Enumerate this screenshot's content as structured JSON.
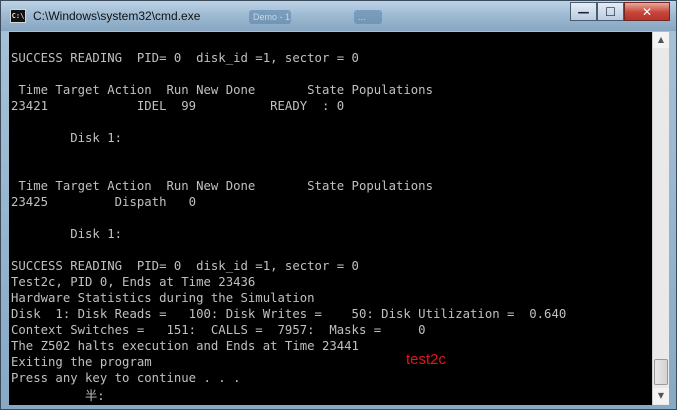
{
  "window": {
    "title": "C:\\Windows\\system32\\cmd.exe",
    "icon": "cmd-icon",
    "icon_text": "C:\\",
    "ghost_tabs": [
      "Demo - 1 - ...",
      "..."
    ],
    "controls": {
      "minimize": "—",
      "maximize": "☐",
      "close": "✕"
    }
  },
  "console": {
    "lines": [
      "SUCCESS READING  PID= 0  disk_id =1, sector = 0",
      "",
      " Time Target Action  Run New Done       State Populations",
      "23421            IDEL  99          READY  : 0",
      "",
      "        Disk 1:",
      "",
      "",
      " Time Target Action  Run New Done       State Populations",
      "23425         Dispath   0",
      "",
      "        Disk 1:",
      "",
      "SUCCESS READING  PID= 0  disk_id =1, sector = 0",
      "Test2c, PID 0, Ends at Time 23436",
      "Hardware Statistics during the Simulation",
      "Disk  1: Disk Reads =   100: Disk Writes =    50: Disk Utilization =  0.640",
      "Context Switches =   151:  CALLS =  7957:  Masks =     0",
      "The Z502 halts execution and Ends at Time 23441",
      "Exiting the program",
      "Press any key to continue . . ."
    ],
    "cursor_text": "半:",
    "annotation": "test2c",
    "annotation_color": "#e8121a"
  },
  "scrollbar": {
    "up_arrow": "▲",
    "down_arrow": "▼"
  }
}
